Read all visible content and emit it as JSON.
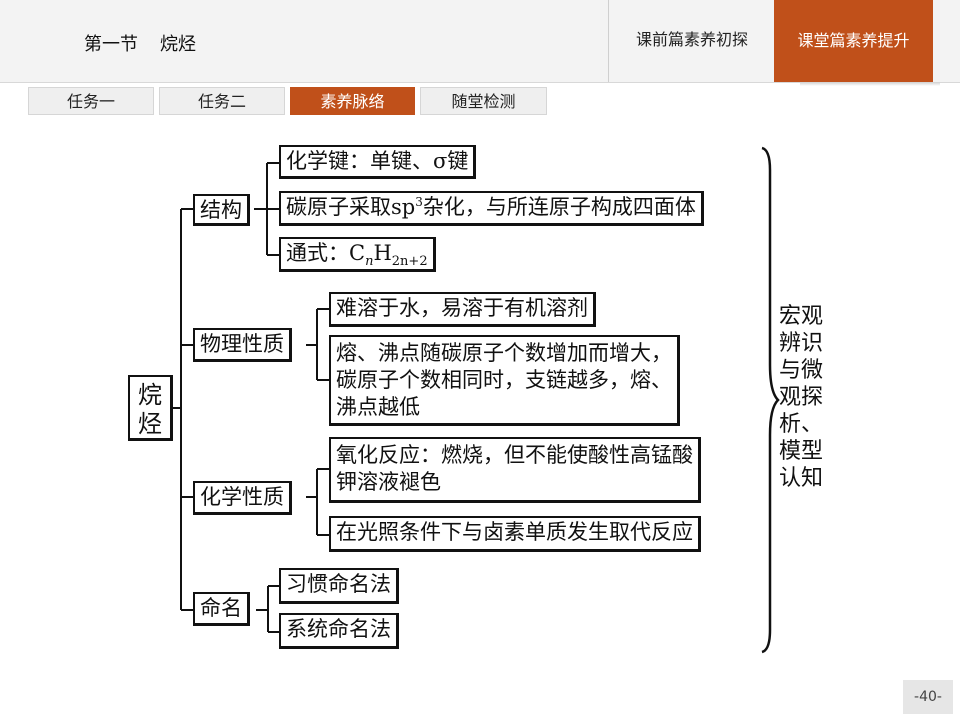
{
  "header": {
    "section": "第一节",
    "topic": "烷烃",
    "tabs": [
      {
        "label": "课前篇素养初探",
        "active": false
      },
      {
        "label": "课堂篇素养提升",
        "active": true
      }
    ]
  },
  "subtabs": [
    {
      "label": "任务一",
      "active": false
    },
    {
      "label": "任务二",
      "active": false
    },
    {
      "label": "素养脉络",
      "active": true
    },
    {
      "label": "随堂检测",
      "active": false
    }
  ],
  "diagram": {
    "root": [
      "烷",
      "烃"
    ],
    "branches": {
      "structure": {
        "label": "结构",
        "items": {
          "bond": "化学键：单键、σ键",
          "hybrid_pre": "碳原子采取sp",
          "hybrid_sup": "3",
          "hybrid_post": "杂化，与所连原子构成四面体",
          "formula_pre": "通式：C",
          "formula_n": "n",
          "formula_h": "H",
          "formula_sub": "2n+2"
        }
      },
      "physical": {
        "label": "物理性质",
        "items": {
          "solubility": "难溶于水，易溶于有机溶剂",
          "melt_line1": "熔、沸点随碳原子个数增加而增大，",
          "melt_line2": "碳原子个数相同时，支链越多，熔、",
          "melt_line3": "沸点越低"
        }
      },
      "chemical": {
        "label": "化学性质",
        "items": {
          "oxidation_line1": "氧化反应：燃烧，但不能使酸性高锰酸",
          "oxidation_line2": "钾溶液褪色",
          "substitution": "在光照条件下与卤素单质发生取代反应"
        }
      },
      "naming": {
        "label": "命名",
        "items": {
          "common": "习惯命名法",
          "systematic": "系统命名法"
        }
      }
    },
    "side_label": [
      "宏观",
      "辨识",
      "与微",
      "观探",
      "析、",
      "模型",
      "认知"
    ]
  },
  "page_number": "-40-"
}
